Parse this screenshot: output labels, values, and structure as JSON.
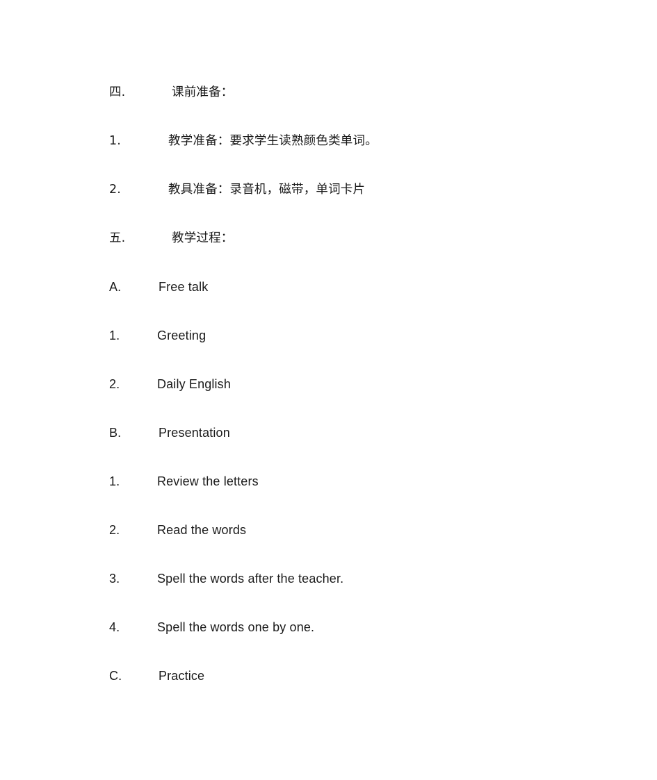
{
  "document": {
    "background_color": "#ffffff",
    "text_color": "#1a1a1a",
    "lines": [
      {
        "marker": "四.",
        "content": "课前准备："
      },
      {
        "marker": "1.",
        "content": "教学准备：要求学生读熟颜色类单词。"
      },
      {
        "marker": "2.",
        "content": "教具准备：录音机，磁带，单词卡片"
      },
      {
        "marker": "五.",
        "content": "教学过程："
      },
      {
        "marker": "A.",
        "content": "Free talk"
      },
      {
        "marker": "1.",
        "content": "Greeting"
      },
      {
        "marker": "2.",
        "content": "Daily English"
      },
      {
        "marker": "B.",
        "content": "Presentation"
      },
      {
        "marker": "1.",
        "content": "Review the letters"
      },
      {
        "marker": "2.",
        "content": "Read the words"
      },
      {
        "marker": "3.",
        "content": "Spell the words after the teacher."
      },
      {
        "marker": "4.",
        "content": "Spell the words one by one."
      },
      {
        "marker": "C.",
        "content": "Practice"
      }
    ]
  }
}
